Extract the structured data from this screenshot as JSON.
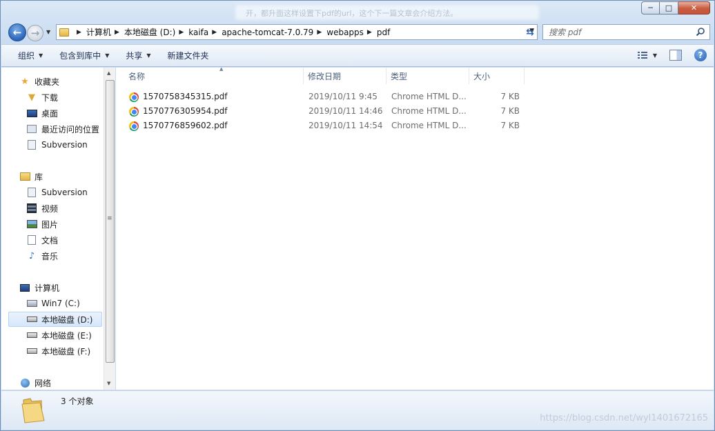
{
  "window": {
    "title": "开，都升面这样设置下pdf的url，这个下一篇文章会介绍方法。",
    "controls": {
      "minimize": "─",
      "maximize": "□",
      "close": "✕"
    }
  },
  "address": {
    "breadcrumbs": [
      "计算机",
      "本地磁盘 (D:)",
      "kaifa",
      "apache-tomcat-7.0.79",
      "webapps",
      "pdf"
    ],
    "refresh_icon": "refresh-icon"
  },
  "search": {
    "placeholder": "搜索 pdf"
  },
  "toolbar": {
    "organize": "组织",
    "include_in_library": "包含到库中",
    "share": "共享",
    "new_folder": "新建文件夹"
  },
  "sidebar": {
    "favorites": {
      "header": "收藏夹",
      "items": [
        "下载",
        "桌面",
        "最近访问的位置",
        "Subversion"
      ]
    },
    "libraries": {
      "header": "库",
      "items": [
        "Subversion",
        "视频",
        "图片",
        "文档",
        "音乐"
      ]
    },
    "computer": {
      "header": "计算机",
      "items": [
        "Win7 (C:)",
        "本地磁盘 (D:)",
        "本地磁盘 (E:)",
        "本地磁盘 (F:)"
      ],
      "selected": "本地磁盘 (D:)"
    },
    "network": {
      "header": "网络"
    }
  },
  "columns": {
    "name": "名称",
    "date": "修改日期",
    "type": "类型",
    "size": "大小"
  },
  "files": [
    {
      "name": "1570758345315.pdf",
      "date": "2019/10/11 9:45",
      "type": "Chrome HTML D...",
      "size": "7 KB"
    },
    {
      "name": "1570776305954.pdf",
      "date": "2019/10/11 14:46",
      "type": "Chrome HTML D...",
      "size": "7 KB"
    },
    {
      "name": "1570776859602.pdf",
      "date": "2019/10/11 14:54",
      "type": "Chrome HTML D...",
      "size": "7 KB"
    }
  ],
  "status": {
    "count": "3 个对象",
    "watermark": "https://blog.csdn.net/wyl1401672165"
  }
}
